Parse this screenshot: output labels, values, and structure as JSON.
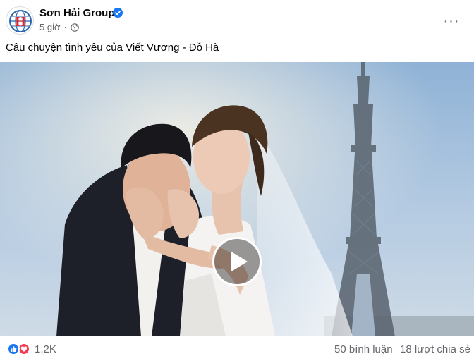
{
  "post": {
    "page_name": "Sơn Hải Group",
    "time": "5 giờ",
    "separator": "·",
    "caption": "Câu chuyện tình yêu của Viết Vương - Đỗ Hà",
    "avatar_monogram": "H",
    "more_icon_glyph": "···"
  },
  "icons": {
    "verified": "verified-badge-icon",
    "privacy": "globe-icon",
    "more": "more-horizontal-icon",
    "play": "play-icon",
    "like": "like-reaction-icon",
    "love": "love-reaction-icon"
  },
  "colors": {
    "brand_blue": "#1877f2",
    "love_red": "#f33e58",
    "secondary_text": "#65676b"
  },
  "engagement": {
    "reactions_count": "1,2K",
    "comments": "50 bình luận",
    "shares": "18 lượt chia sẻ"
  }
}
